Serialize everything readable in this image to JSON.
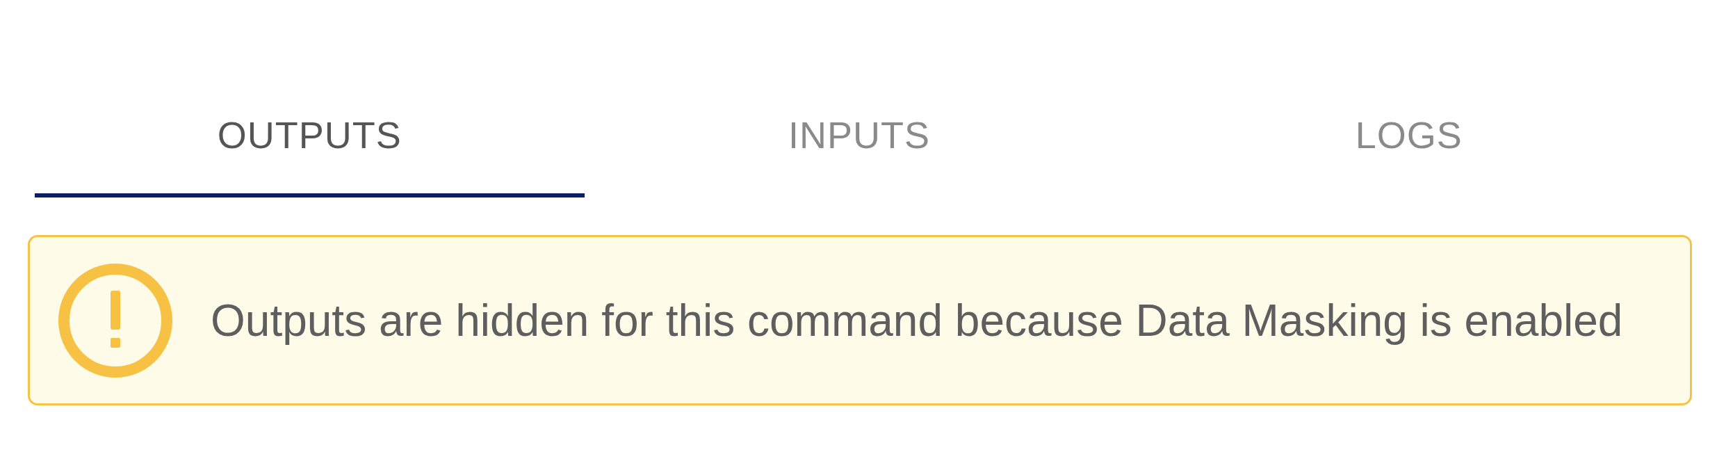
{
  "tabs": [
    {
      "label": "OUTPUTS",
      "selected": true
    },
    {
      "label": "INPUTS",
      "selected": false
    },
    {
      "label": "LOGS",
      "selected": false
    }
  ],
  "alert": {
    "kind": "warning",
    "message": "Outputs are hidden for this command because Data Masking is enabled"
  }
}
